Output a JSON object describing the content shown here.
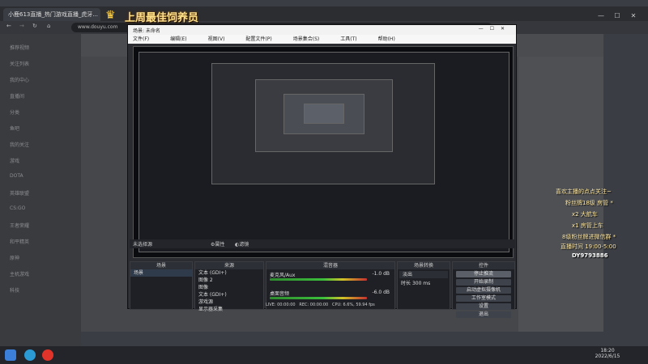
{
  "browser": {
    "tabs": [
      {
        "label": "小鹿613直播_热门游戏直播_虎牙..."
      },
      {
        "label": "场景: 未命名"
      }
    ],
    "address": "www.douyu.com",
    "new_tab": "+"
  },
  "banner": {
    "title": "上周最佳饲养员"
  },
  "sidebar": {
    "items": [
      "推荐视频",
      "关注列表",
      "我的中心",
      "直播间",
      "分类",
      "鱼吧",
      "我的关注",
      "游戏",
      "DOTA",
      "英雄联盟",
      "CS:GO",
      "王者荣耀",
      "和平精英",
      "原神",
      "主机游戏",
      "科技"
    ]
  },
  "obs": {
    "title": "场景: 未命名",
    "menu": [
      "文件(F)",
      "编辑(E)",
      "视图(V)",
      "配置文件(P)",
      "场景集合(S)",
      "工具(T)",
      "帮助(H)"
    ],
    "no_source_label": "未选择源",
    "props_label": "属性",
    "filters_label": "滤镜",
    "scenes": {
      "header": "场景",
      "items": [
        "场景"
      ]
    },
    "sources": {
      "header": "来源",
      "items": [
        "文本 (GDI+)",
        "图像 2",
        "图像",
        "文本 (GDI+)",
        "游戏源",
        "显示器采集"
      ]
    },
    "mixer": {
      "header": "混音器",
      "channels": [
        {
          "name": "麦克风/Aux",
          "db": "-1.0 dB"
        },
        {
          "name": "桌面音频",
          "db": "-6.0 dB"
        }
      ]
    },
    "transitions": {
      "header": "场景转换",
      "type": "淡出",
      "duration_label": "时长",
      "duration": "300 ms"
    },
    "controls": {
      "header": "控件",
      "buttons": [
        "停止推流",
        "开始录制",
        "启动虚拟摄像机",
        "工作室模式",
        "设置",
        "退出"
      ]
    },
    "status": {
      "live": "LIVE: 00:00:00",
      "rec": "REC: 00:00:00",
      "cpu": "CPU: 6.6%, 59.94 fps"
    }
  },
  "overlay": {
    "lines": [
      "喜欢主播的点点关注~",
      "粉丝牌18级  房管 *",
      "x2  大航车",
      "x1  房管上车",
      "8级粉丝牌进微信群 *",
      "直播时间  19:00-5:00",
      "DY9793886"
    ]
  },
  "taskbar": {
    "time": "18:20",
    "date": "2022/6/15"
  }
}
